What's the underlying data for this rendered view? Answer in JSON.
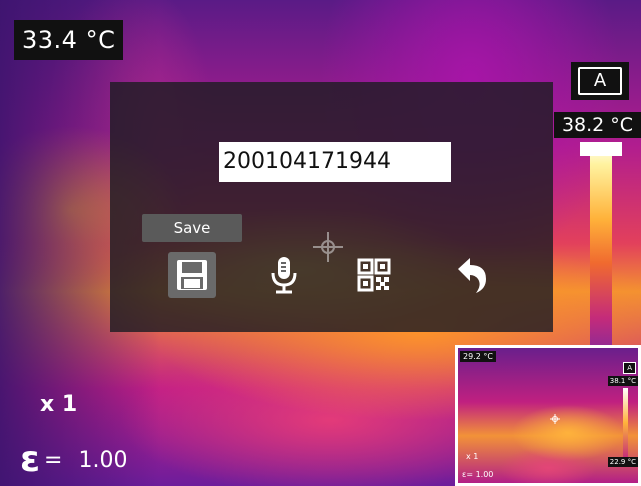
{
  "top_left_temp": "33.4 °C",
  "right_panel": {
    "auto_label": "A",
    "max_temp": "38.2 °C"
  },
  "dialog": {
    "filename": "200104171944",
    "tooltip": "Save",
    "buttons": [
      {
        "name": "save",
        "icon": "floppy-disk-icon",
        "selected": true
      },
      {
        "name": "voice-note",
        "icon": "microphone-icon",
        "selected": false
      },
      {
        "name": "qr-code",
        "icon": "qr-code-icon",
        "selected": false
      },
      {
        "name": "back",
        "icon": "undo-arrow-icon",
        "selected": false
      }
    ]
  },
  "zoom": "x 1",
  "emissivity": {
    "symbol": "ε",
    "equals": "=",
    "value": "1.00"
  },
  "thumbnail": {
    "temp": "29.2 °C",
    "auto_label": "A",
    "max_temp": "38.1 °C",
    "min_temp": "22.9 °C",
    "zoom": "x 1",
    "emissivity": "ε= 1.00"
  }
}
